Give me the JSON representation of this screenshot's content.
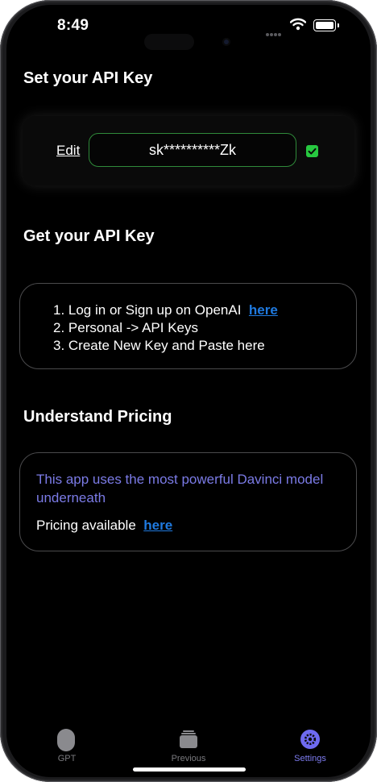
{
  "status_bar": {
    "time": "8:49",
    "icons": [
      "signal-dots-icon",
      "wifi-icon",
      "battery-icon"
    ]
  },
  "sections": {
    "set_key_title": "Set your API Key",
    "get_key_title": "Get your API Key",
    "pricing_title": "Understand Pricing"
  },
  "api_key": {
    "edit_label": "Edit",
    "value": "sk**********Zk",
    "validated": true
  },
  "steps": {
    "step1": "1. Log in or Sign up on OpenAI",
    "step1_link": "here",
    "step2": "2. Personal -> API Keys",
    "step3": "3. Create New Key and Paste here"
  },
  "pricing": {
    "description": "This app uses the most powerful Davinci model underneath",
    "available_label": "Pricing available",
    "link": "here"
  },
  "tabbar": {
    "items": [
      {
        "label": "GPT",
        "icon": "gpt-icon"
      },
      {
        "label": "Previous",
        "icon": "previous-icon"
      },
      {
        "label": "Settings",
        "icon": "gear-icon",
        "active": true
      }
    ]
  },
  "colors": {
    "background": "#000000",
    "link": "#1f7ae0",
    "accent": "#6e6af0",
    "success": "#27c840"
  }
}
